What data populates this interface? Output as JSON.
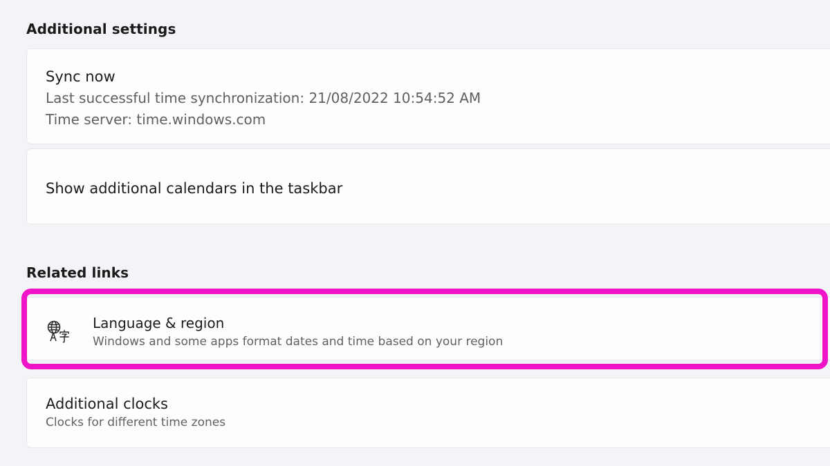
{
  "sections": {
    "additional_settings": "Additional settings",
    "related_links": "Related links"
  },
  "sync": {
    "title": "Sync now",
    "last_sync": "Last successful time synchronization: 21/08/2022 10:54:52 AM",
    "time_server": "Time server: time.windows.com"
  },
  "calendars": {
    "title": "Show additional calendars in the taskbar"
  },
  "language_region": {
    "title": "Language & region",
    "description": "Windows and some apps format dates and time based on your region",
    "icon": "language-globe-icon"
  },
  "additional_clocks": {
    "title": "Additional clocks",
    "description": "Clocks for different time zones"
  },
  "colors": {
    "highlight": "#f014c8",
    "background": "#f2f4f8",
    "card": "#fdfdfd"
  }
}
